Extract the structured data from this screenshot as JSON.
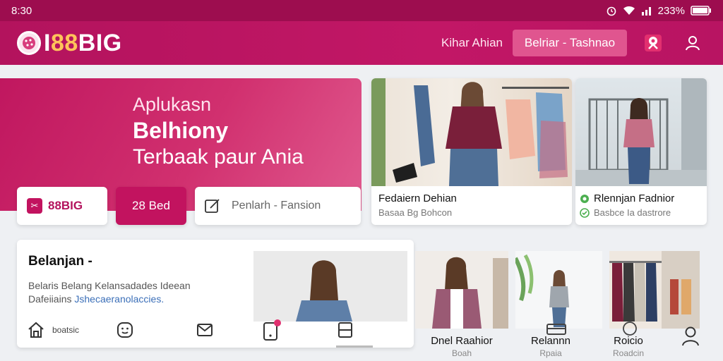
{
  "status_bar": {
    "time": "8:30",
    "battery": "233%"
  },
  "header": {
    "logo_prefix": "I",
    "logo_gold": "88",
    "logo_suffix": "BIG",
    "link": "Kihar Ahian",
    "tab": "Belriar - Tashnao"
  },
  "hero": {
    "line1": "Aplukasn",
    "line2": "Belhiony",
    "line3": "Terbaak paur Ania"
  },
  "chips": {
    "brand": "88BIG",
    "active": "28 Bed",
    "search": "Penlarh - Fansion"
  },
  "cards": [
    {
      "title": "Fedaiern Dehian",
      "subtitle": "Basaa Bg Bohcon"
    },
    {
      "title": "Rlennjan Fadnior",
      "subtitle": "Basbce Ia dastrore"
    }
  ],
  "bottom": {
    "title": "Belanjan -",
    "desc_line1": "Belaris Belang Kelansadades Ideean",
    "desc_plain": "Dafeiiains ",
    "desc_accent": "Jshecaeranolaccies."
  },
  "nav": {
    "home_label": "boatsic"
  },
  "products": [
    {
      "label": "Dnel Raahior",
      "sub": "Boah"
    },
    {
      "label": "Relannn",
      "sub": "Rpaia"
    },
    {
      "label": "Roicio",
      "sub": "Roadcin"
    }
  ],
  "colors": {
    "brand": "#b3135d",
    "accent": "#c2135f",
    "link": "#3b6fb8"
  }
}
